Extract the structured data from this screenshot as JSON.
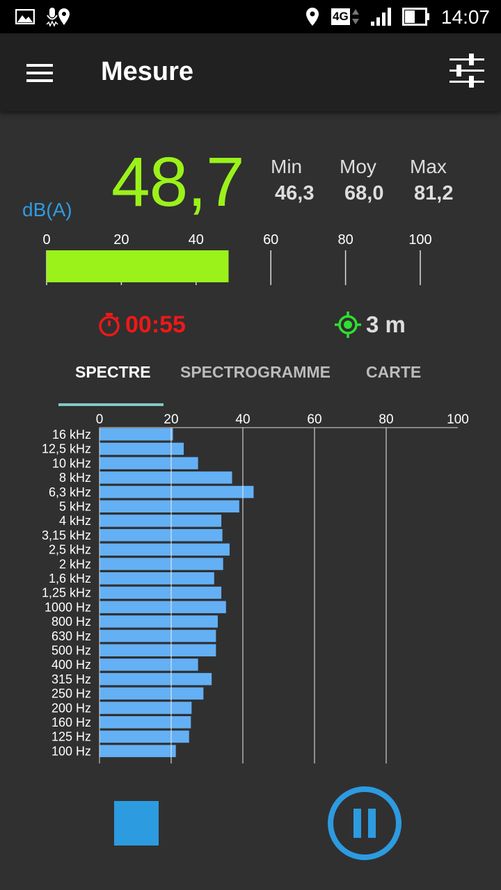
{
  "status_bar": {
    "time": "14:07",
    "network": "4G",
    "left_icons": [
      "image-icon",
      "mic-icon",
      "location-icon"
    ],
    "right_icons": [
      "location-icon",
      "4g-icon",
      "signal-icon",
      "battery-icon"
    ]
  },
  "app_bar": {
    "title": "Mesure"
  },
  "meter": {
    "unit": "dB(A)",
    "value": "48,7",
    "value_number": 48.7,
    "stats": [
      {
        "label": "Min",
        "value": "46,3"
      },
      {
        "label": "Moy",
        "value": "68,0"
      },
      {
        "label": "Max",
        "value": "81,2"
      }
    ],
    "scale_ticks": [
      "0",
      "20",
      "40",
      "60",
      "80",
      "100"
    ],
    "timer": "00:55",
    "accuracy": "3 m",
    "bar_color": "#9af21a",
    "value_color": "#9af21a",
    "timer_color": "#f01818",
    "accent_color": "#2d9be0"
  },
  "tabs": [
    {
      "label": "SPECTRE",
      "active": true
    },
    {
      "label": "SPECTROGRAMME",
      "active": false
    },
    {
      "label": "CARTE",
      "active": false
    }
  ],
  "chart_data": {
    "type": "bar",
    "orientation": "horizontal",
    "categories": [
      "16 kHz",
      "12,5 kHz",
      "10 kHz",
      "8 kHz",
      "6,3 kHz",
      "5 kHz",
      "4 kHz",
      "3,15 kHz",
      "2,5 kHz",
      "2 kHz",
      "1,6 kHz",
      "1,25 kHz",
      "1000 Hz",
      "800 Hz",
      "630 Hz",
      "500 Hz",
      "400 Hz",
      "315 Hz",
      "250 Hz",
      "200 Hz",
      "160 Hz",
      "125 Hz",
      "100 Hz"
    ],
    "values": [
      20.5,
      23.5,
      27.5,
      37,
      43,
      39,
      34,
      34.3,
      36.3,
      34.5,
      32,
      34,
      35.3,
      33,
      32.5,
      32.5,
      27.5,
      31.3,
      29,
      25.7,
      25.5,
      25,
      21.3
    ],
    "xlim": [
      0,
      100
    ],
    "x_ticks": [
      "0",
      "20",
      "40",
      "60",
      "80",
      "100"
    ],
    "bar_color": "#64b0f5",
    "grid": true
  }
}
